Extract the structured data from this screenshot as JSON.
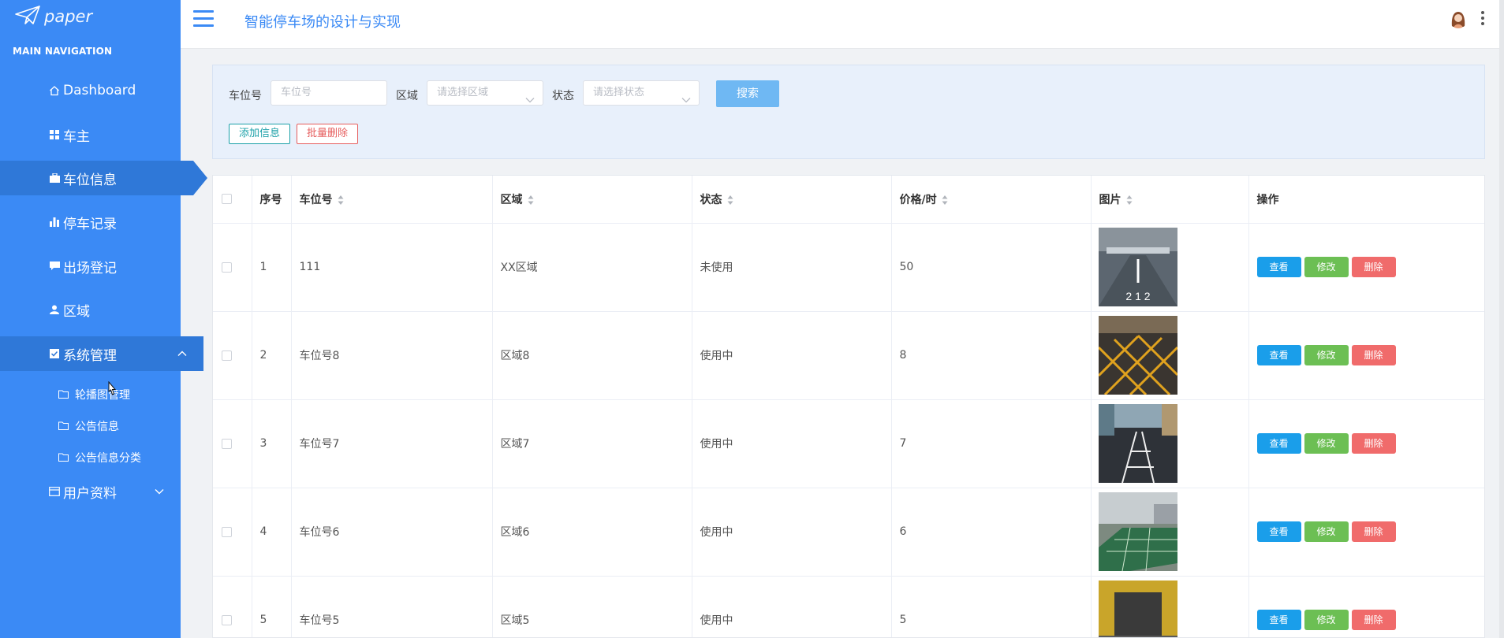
{
  "brand": {
    "logo_text": "paper"
  },
  "sidebar": {
    "heading": "MAIN NAVIGATION",
    "items": [
      {
        "label": "Dashboard",
        "icon": "home-icon"
      },
      {
        "label": "车主",
        "icon": "grid-icon"
      },
      {
        "label": "车位信息",
        "icon": "briefcase-icon",
        "active": true
      },
      {
        "label": "停车记录",
        "icon": "bar-chart-icon"
      },
      {
        "label": "出场登记",
        "icon": "comment-icon"
      },
      {
        "label": "区域",
        "icon": "user-icon"
      },
      {
        "label": "系统管理",
        "icon": "checkbox-icon",
        "expanded": true
      },
      {
        "label": "用户资料",
        "icon": "card-icon",
        "expanded": false
      }
    ],
    "sub_items": [
      {
        "label": "轮播图管理",
        "icon": "folder-icon"
      },
      {
        "label": "公告信息",
        "icon": "folder-icon"
      },
      {
        "label": "公告信息分类",
        "icon": "folder-icon"
      }
    ]
  },
  "header": {
    "title": "智能停车场的设计与实现"
  },
  "search": {
    "spot_label": "车位号",
    "spot_placeholder": "车位号",
    "area_label": "区域",
    "area_placeholder": "请选择区域",
    "status_label": "状态",
    "status_placeholder": "请选择状态",
    "search_button": "搜索",
    "add_button": "添加信息",
    "batch_delete_button": "批量删除"
  },
  "table": {
    "headers": [
      "序号",
      "车位号",
      "区域",
      "状态",
      "价格/时",
      "图片",
      "操作"
    ],
    "actions": {
      "view": "查看",
      "edit": "修改",
      "delete": "删除"
    },
    "rows": [
      {
        "index": "1",
        "spot": "111",
        "area": "XX区域",
        "status": "未使用",
        "price": "50",
        "image": "parking-garage-212"
      },
      {
        "index": "2",
        "spot": "车位号8",
        "area": "区域8",
        "status": "使用中",
        "price": "8",
        "image": "yellow-grid-lot"
      },
      {
        "index": "3",
        "spot": "车位号7",
        "area": "区域7",
        "status": "使用中",
        "price": "7",
        "image": "street-parking"
      },
      {
        "index": "4",
        "spot": "车位号6",
        "area": "区域6",
        "status": "使用中",
        "price": "6",
        "image": "grass-parking"
      },
      {
        "index": "5",
        "spot": "车位号5",
        "area": "区域5",
        "status": "使用中",
        "price": "5",
        "image": "yellow-garage"
      }
    ]
  },
  "colors": {
    "sidebar": "#3b8af5",
    "sidebar_active": "#2f78d8",
    "accent": "#3b8af5",
    "view": "#1a9eea",
    "edit": "#6cbf54",
    "delete": "#f06b6b"
  }
}
